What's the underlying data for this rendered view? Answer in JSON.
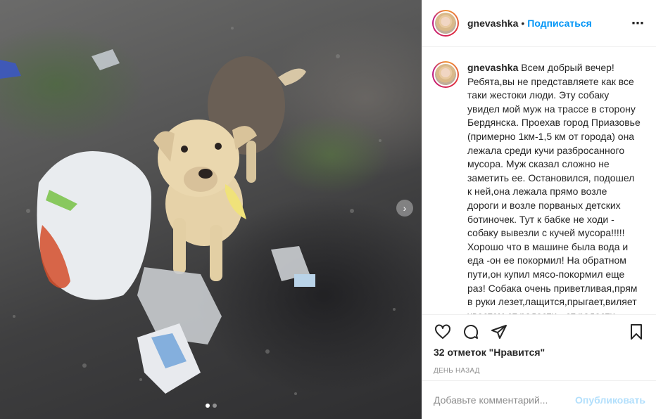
{
  "post": {
    "username": "gnevashka",
    "separator": "•",
    "follow_label": "Подписаться",
    "more_icon": "⋯"
  },
  "caption": {
    "username": "gnevashka",
    "text": "Всем добрый вечер! Ребята,вы не представляете как все таки жестоки люди. Эту собаку увидел мой муж на трассе в сторону Бердянска. Проехав город Приазовье (примерно 1км-1,5 км от города) она лежала среди кучи разбросанного мусора. Муж сказал сложно не заметить ее. Остановился, подошел к ней,она лежала прямо возле дороги и возле порваных детских ботиночек. Тут к бабке не ходи - собаку вывезли с кучей мусора!!!!! Хорошо что в машине была вода и еда -он ее покормил! На обратном пути,он купил мясо-покормил еще раз! Собака очень приветливая,прям в руки лезет,лащится,прыгает,виляет хвостом от радости - от радости"
  },
  "engagement": {
    "likes_text": "32 отметок \"Нравится\"",
    "time_text": "ДЕНЬ НАЗАД"
  },
  "comment": {
    "placeholder": "Добавьте комментарий...",
    "post_label": "Опубликовать"
  },
  "media": {
    "carousel_next_icon": "›",
    "slide_count": 2,
    "active_slide": 1
  },
  "colors": {
    "accent": "#0095f6",
    "post_disabled": "#b2dffc",
    "muted": "#8e8e8e",
    "text": "#262626"
  }
}
